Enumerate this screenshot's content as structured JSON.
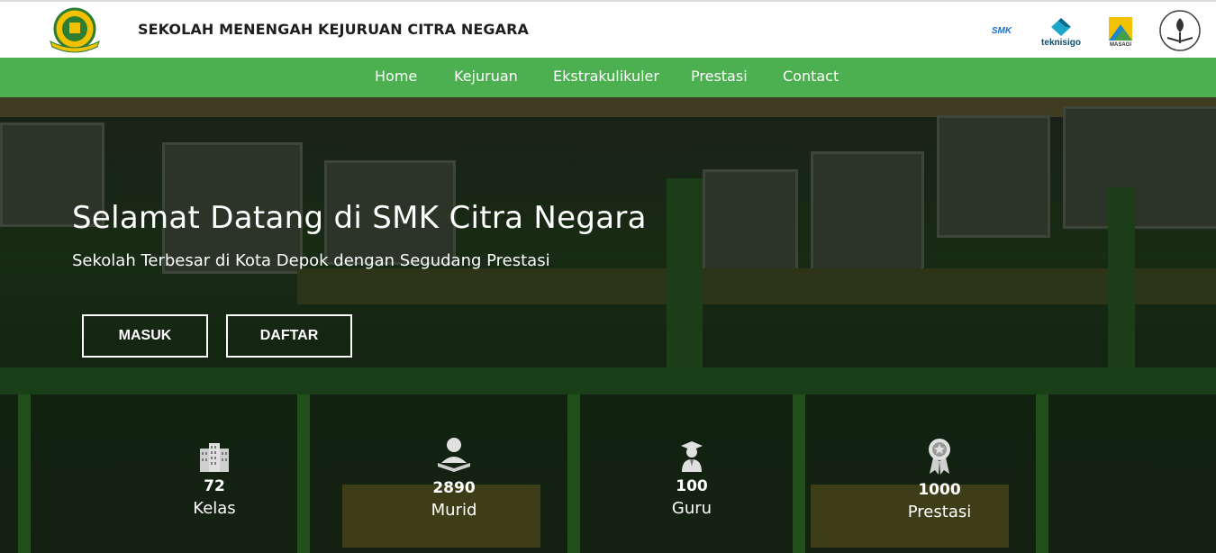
{
  "header": {
    "school_name": "SEKOLAH MENENGAH KEJURUAN CITRA NEGARA",
    "partners": {
      "smk": "SMK",
      "teknisigo": "teknisigo",
      "masagi": "MASAGI",
      "adiwiyata": "ADIWIYATA"
    }
  },
  "nav": {
    "items": [
      "Home",
      "Kejuruan",
      "Ekstrakulikuler",
      "Prestasi",
      "Contact"
    ]
  },
  "hero": {
    "title": "Selamat Datang di SMK Citra Negara",
    "subtitle": "Sekolah Terbesar di Kota Depok dengan Segudang Prestasi",
    "buttons": {
      "masuk": "MASUK",
      "daftar": "DAFTAR"
    }
  },
  "stats": [
    {
      "value": "72",
      "label": "Kelas",
      "icon": "building-icon"
    },
    {
      "value": "2890",
      "label": "Murid",
      "icon": "student-reading-icon"
    },
    {
      "value": "100",
      "label": "Guru",
      "icon": "graduate-icon"
    },
    {
      "value": "1000",
      "label": "Prestasi",
      "icon": "award-ribbon-icon"
    }
  ],
  "colors": {
    "nav": "#4caf50",
    "header_bg": "#ffffff",
    "hero_text": "#ffffff"
  }
}
